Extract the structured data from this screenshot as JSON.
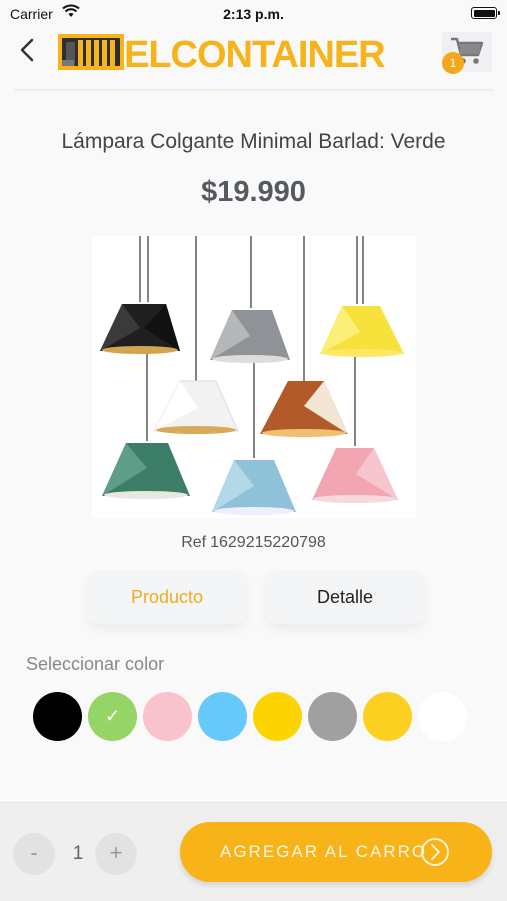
{
  "status_bar": {
    "carrier": "Carrier",
    "time": "2:13 p.m."
  },
  "header": {
    "logo_text": "ELCONTAINER",
    "cart_count": "1",
    "back_icon": "chevron-left-icon",
    "cart_icon": "shopping-cart-icon"
  },
  "product": {
    "title": "Lámpara Colgante Minimal Barlad: Verde",
    "price": "$19.990",
    "ref_prefix": "Ref",
    "ref_number": "1629215220798"
  },
  "tabs": [
    {
      "label": "Producto",
      "active": true
    },
    {
      "label": "Detalle",
      "active": false
    }
  ],
  "color_selector": {
    "label": "Seleccionar color",
    "selected_index": 1,
    "swatches": [
      {
        "color": "#000000"
      },
      {
        "color": "#96d565"
      },
      {
        "color": "#f8c3cc"
      },
      {
        "color": "#66c8fb"
      },
      {
        "color": "#fdd400"
      },
      {
        "color": "#a0a0a0"
      },
      {
        "color": "#fcd01f"
      },
      {
        "color": "#ffffff"
      }
    ]
  },
  "quantity": {
    "minus_label": "-",
    "value": "1",
    "plus_label": "+"
  },
  "add_to_cart": {
    "label": "AGREGAR AL CARRO",
    "icon": "arrow-right-circle-icon"
  },
  "colors": {
    "accent": "#f7b318",
    "badge": "#f5a71c"
  }
}
